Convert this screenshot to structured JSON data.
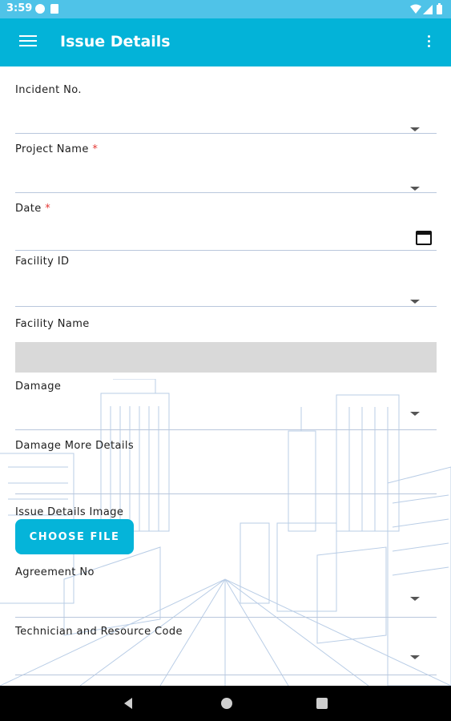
{
  "status_bar": {
    "time": "3:59",
    "left_icons": [
      "pocket-icon",
      "sd-card-icon"
    ],
    "right_icons": [
      "wifi-icon",
      "signal-icon",
      "battery-icon"
    ]
  },
  "app_bar": {
    "title": "Issue Details",
    "menu_icon": "hamburger-menu-icon",
    "overflow_icon": "more-vertical-icon",
    "color": "#03b3d8"
  },
  "form": {
    "fields": [
      {
        "label": "Incident No.",
        "required": false,
        "control": "dropdown",
        "value": ""
      },
      {
        "label": "Project Name",
        "required": true,
        "control": "dropdown",
        "value": ""
      },
      {
        "label": "Date",
        "required": true,
        "control": "date",
        "value": ""
      },
      {
        "label": "Facility ID",
        "required": false,
        "control": "dropdown",
        "value": ""
      },
      {
        "label": "Facility Name",
        "required": false,
        "control": "readonly",
        "value": ""
      },
      {
        "label": "Damage",
        "required": false,
        "control": "dropdown",
        "value": ""
      },
      {
        "label": "Damage More Details",
        "required": false,
        "control": "text",
        "value": ""
      },
      {
        "label": "Issue Details Image",
        "required": false,
        "control": "file",
        "value": ""
      },
      {
        "label": "Agreement No",
        "required": false,
        "control": "dropdown",
        "value": ""
      },
      {
        "label": "Technician and Resource Code",
        "required": false,
        "control": "dropdown",
        "value": ""
      }
    ],
    "required_mark": "*",
    "choose_file_label": "CHOOSE FILE"
  },
  "nav_bar": {
    "buttons": [
      "back-icon",
      "home-icon",
      "recent-apps-icon"
    ]
  },
  "colors": {
    "accent": "#03b3d8",
    "required": "#e53935",
    "status_bar": "#4fc3e8"
  }
}
